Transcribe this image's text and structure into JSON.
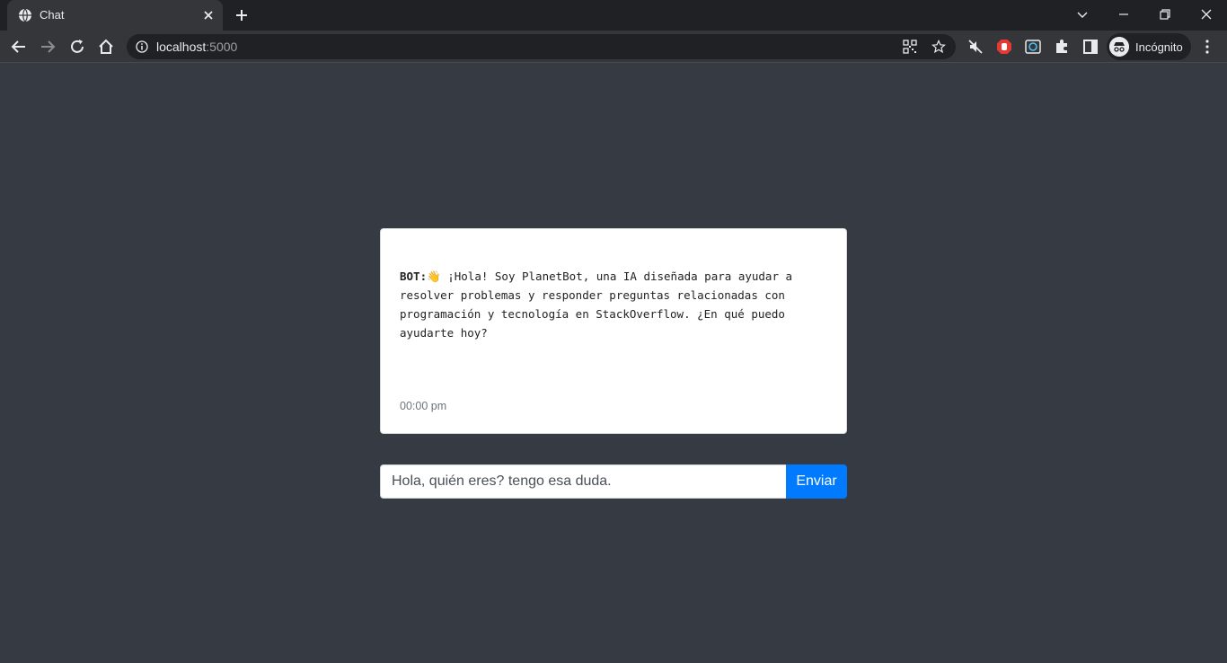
{
  "browser": {
    "tab_title": "Chat",
    "url_host": "localhost",
    "url_port": ":5000",
    "profile_label": "Incógnito"
  },
  "chat": {
    "sender": "BOT:",
    "emoji": "👋",
    "message": " ¡Hola! Soy PlanetBot, una IA diseñada para ayudar a resolver problemas y responder preguntas relacionadas con programación y tecnología en StackOverflow. ¿En qué puedo ayudarte hoy?",
    "timestamp": "00:00 pm"
  },
  "composer": {
    "input_value": "Hola, quién eres? tengo esa duda.",
    "send_label": "Enviar"
  },
  "colors": {
    "page_bg": "#353a43",
    "send_button": "#007bff"
  }
}
